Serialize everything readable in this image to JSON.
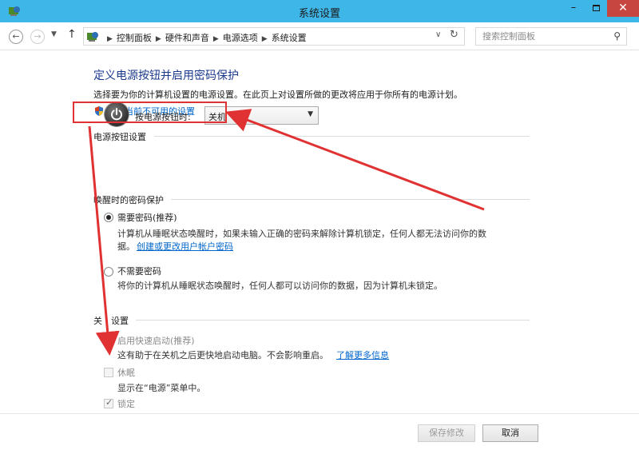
{
  "window": {
    "title": "系统设置",
    "minimize": "–",
    "close": "✕"
  },
  "nav": {
    "breadcrumbs": [
      "控制面板",
      "硬件和声音",
      "电源选项",
      "系统设置"
    ],
    "search_placeholder": "搜索控制面板"
  },
  "main": {
    "heading": "定义电源按钮并启用密码保护",
    "description": "选择要为你的计算机设置的电源设置。在此页上对设置所做的更改将应用于你所有的电源计划。",
    "change_link": "更改当前不可用的设置"
  },
  "power_section": {
    "title": "电源按钮设置",
    "button_label": "按电源按钮时:",
    "selected": "关机"
  },
  "password_section": {
    "title": "唤醒时的密码保护",
    "options": [
      {
        "label": "需要密码(推荐)",
        "checked": true,
        "desc": "计算机从睡眠状态唤醒时，如果未输入正确的密码来解除计算机锁定，任何人都无法访问你的数",
        "desc2": "据。",
        "link": "创建或更改用户帐户密码"
      },
      {
        "label": "不需要密码",
        "checked": false,
        "desc": "将你的计算机从睡眠状态唤醒时，任何人都可以访问你的数据，因为计算机未锁定。"
      }
    ]
  },
  "shutdown_section": {
    "title_a": "关",
    "title_b": "设置",
    "items": [
      {
        "label": "启用快速启动(推荐)",
        "checked": false,
        "desc": "这有助于在关机之后更快地启动电脑。不会影响重启。",
        "link": "了解更多信息"
      },
      {
        "label": "休眠",
        "checked": false,
        "desc": "显示在“电源”菜单中。"
      },
      {
        "label": "锁定",
        "checked": true
      }
    ]
  },
  "footer": {
    "save": "保存修改",
    "cancel": "取消"
  },
  "colors": {
    "titlebar": "#3fb6e8",
    "link": "#0066cc",
    "annotation": "#e03232",
    "close": "#c7463f"
  }
}
